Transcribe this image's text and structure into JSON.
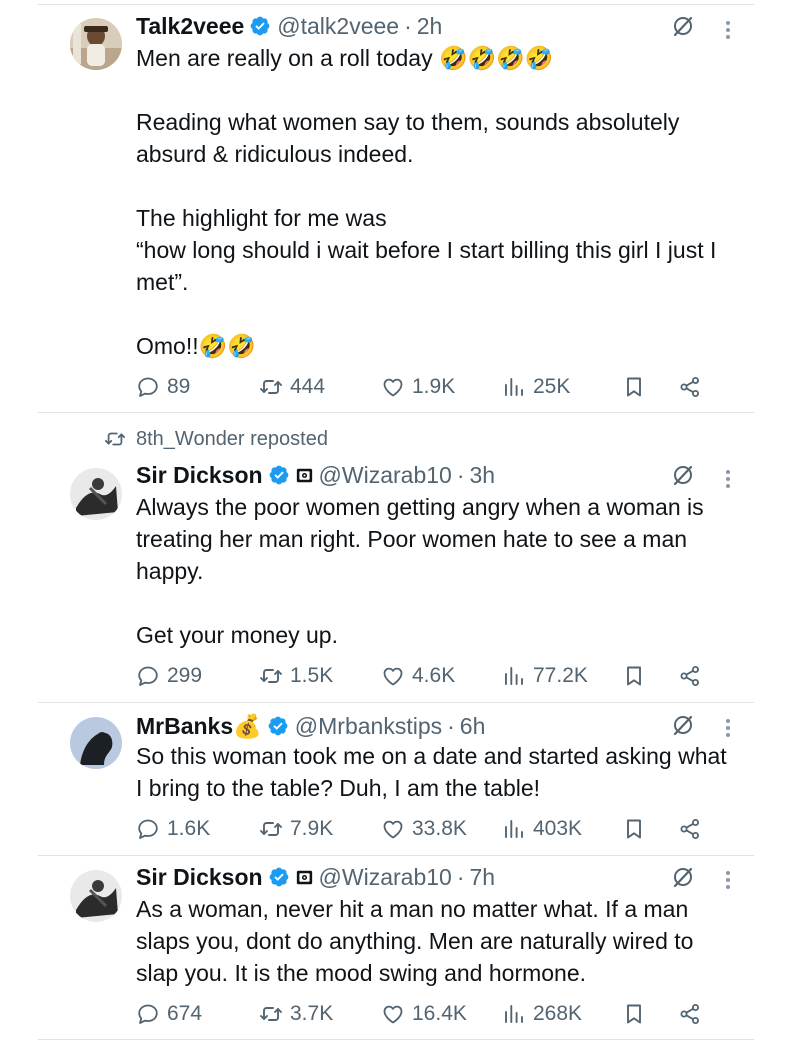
{
  "repost_banner": {
    "text": "8th_Wonder reposted",
    "icon": "repost-icon"
  },
  "tweets": [
    {
      "name": "Talk2veee",
      "handle": "@talk2veee",
      "dot": "·",
      "time": "2h",
      "text": "Men are really on a roll today 🤣🤣🤣🤣\n\nReading what women say to them, sounds absolutely absurd & ridiculous indeed.\n\nThe highlight for me was\n “how long should i wait before I start billing this girl I just I met”.\n\nOmo!!🤣🤣",
      "replies": "89",
      "reposts": "444",
      "likes": "1.9K",
      "views": "25K"
    },
    {
      "name": "Sir Dickson",
      "handle": "@Wizarab10",
      "dot": "·",
      "time": "3h",
      "text": "Always the poor women getting angry when a woman is treating her man right. Poor women hate to see a man happy.\n\nGet your money up.",
      "replies": "299",
      "reposts": "1.5K",
      "likes": "4.6K",
      "views": "77.2K"
    },
    {
      "name": "MrBanks💰",
      "handle": "@Mrbankstips",
      "dot": "·",
      "time": "6h",
      "text": "So this woman took me on a date and started asking what I bring to the table? Duh, I am the table!",
      "replies": "1.6K",
      "reposts": "7.9K",
      "likes": "33.8K",
      "views": "403K"
    },
    {
      "name": "Sir Dickson",
      "handle": "@Wizarab10",
      "dot": "·",
      "time": "7h",
      "text": "As a woman, never hit a man no matter what. If a man slaps you, dont do anything. Men are naturally wired to slap you. It is the mood swing and hormone.",
      "replies": "674",
      "reposts": "3.7K",
      "likes": "16.4K",
      "views": "268K"
    }
  ],
  "colors": {
    "text": "#0f1419",
    "secondary": "#536471",
    "verified": "#1d9bf0",
    "divider": "#dfe3e6"
  }
}
